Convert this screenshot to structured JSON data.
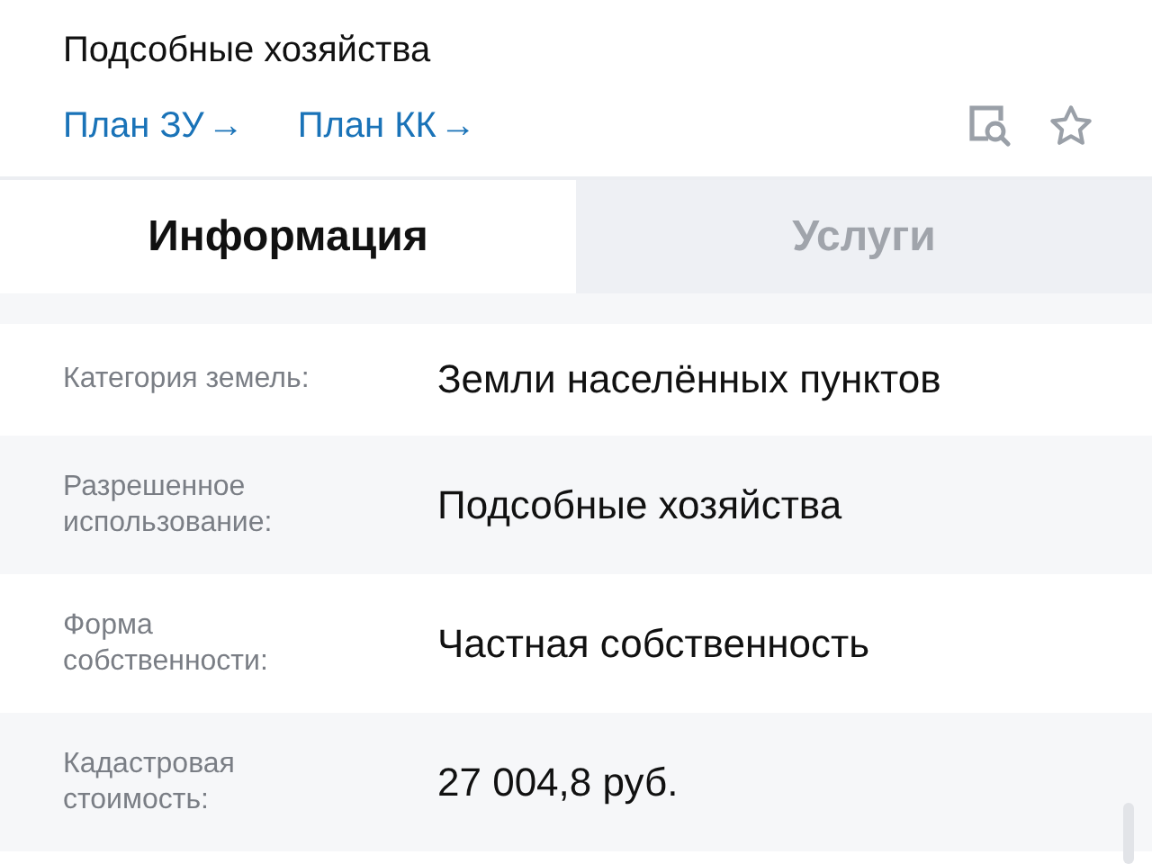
{
  "subtitle": "Подсобные хозяйства",
  "links": [
    {
      "label": "План ЗУ",
      "arrow": "→"
    },
    {
      "label": "План КК",
      "arrow": "→"
    }
  ],
  "tabs": [
    {
      "label": "Информация",
      "selected": true
    },
    {
      "label": "Услуги",
      "selected": false
    }
  ],
  "rows": [
    {
      "label": "Категория земель:",
      "value": "Земли населённых пунктов"
    },
    {
      "label": "Разрешенное использование:",
      "value": "Подсобные хозяйства"
    },
    {
      "label": "Форма собственности:",
      "value": "Частная собственность"
    },
    {
      "label": "Кадастровая стоимость:",
      "value": "27 004,8 руб."
    }
  ]
}
